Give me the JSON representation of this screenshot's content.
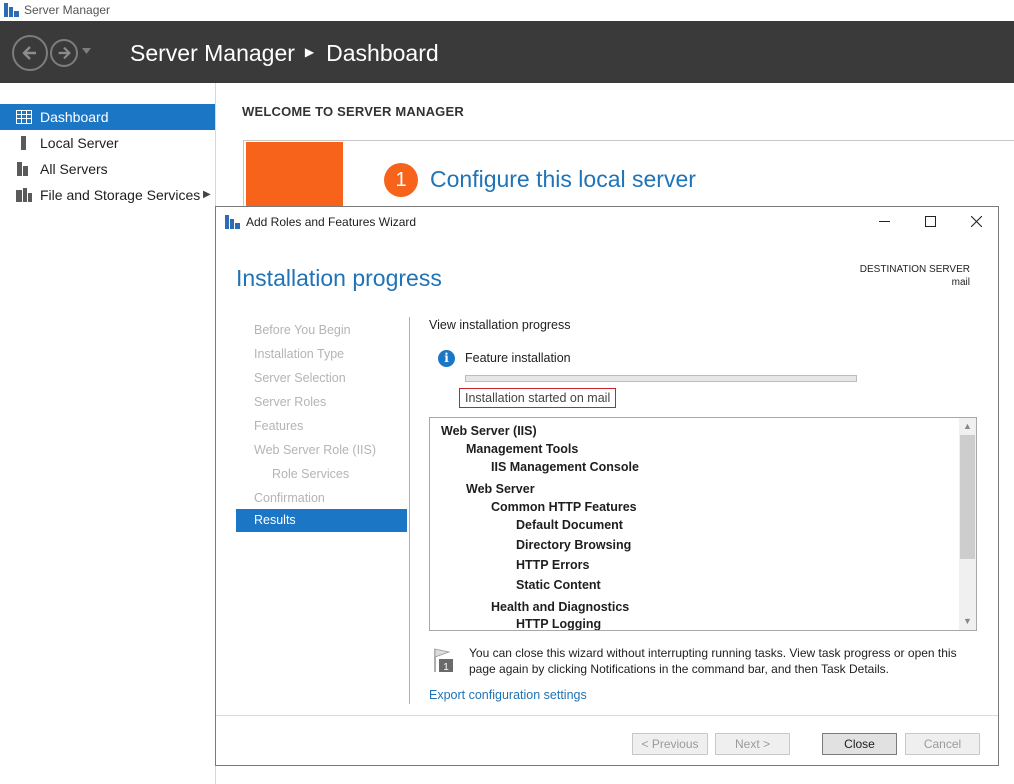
{
  "window": {
    "title": "Server Manager"
  },
  "header": {
    "app": "Server Manager",
    "page": "Dashboard"
  },
  "nav": {
    "items": [
      {
        "label": "Dashboard",
        "icon": "dashboard-icon",
        "active": true
      },
      {
        "label": "Local Server",
        "icon": "server-icon"
      },
      {
        "label": "All Servers",
        "icon": "servers-icon"
      },
      {
        "label": "File and Storage Services",
        "icon": "storage-icon"
      }
    ]
  },
  "welcome": {
    "heading": "WELCOME TO SERVER MANAGER",
    "step_number": "1",
    "configure_label": "Configure this local server"
  },
  "wizard": {
    "title": "Add Roles and Features Wizard",
    "heading": "Installation progress",
    "destination_label": "DESTINATION SERVER",
    "destination_value": "mail",
    "steps": [
      "Before You Begin",
      "Installation Type",
      "Server Selection",
      "Server Roles",
      "Features",
      "Web Server Role (IIS)",
      "Role Services",
      "Confirmation",
      "Results"
    ],
    "view_progress": "View installation progress",
    "feature_install": "Feature installation",
    "progress_fraction": 0,
    "status": "Installation started on mail",
    "tree": [
      "Web Server (IIS)",
      "Management Tools",
      "IIS Management Console",
      "Web Server",
      "Common HTTP Features",
      "Default Document",
      "Directory Browsing",
      "HTTP Errors",
      "Static Content",
      "Health and Diagnostics",
      "HTTP Logging"
    ],
    "note_badge": "1",
    "note": "You can close this wizard without interrupting running tasks. View task progress or open this page again by clicking Notifications in the command bar, and then Task Details.",
    "export_link": "Export configuration settings",
    "buttons": {
      "previous": "< Previous",
      "next": "Next >",
      "close": "Close",
      "cancel": "Cancel"
    }
  },
  "colors": {
    "accent": "#1b77c6",
    "link": "#1f73b7",
    "orange": "#f7631b",
    "header_bg": "#3a3a3a",
    "status_border": "#c8232c"
  }
}
